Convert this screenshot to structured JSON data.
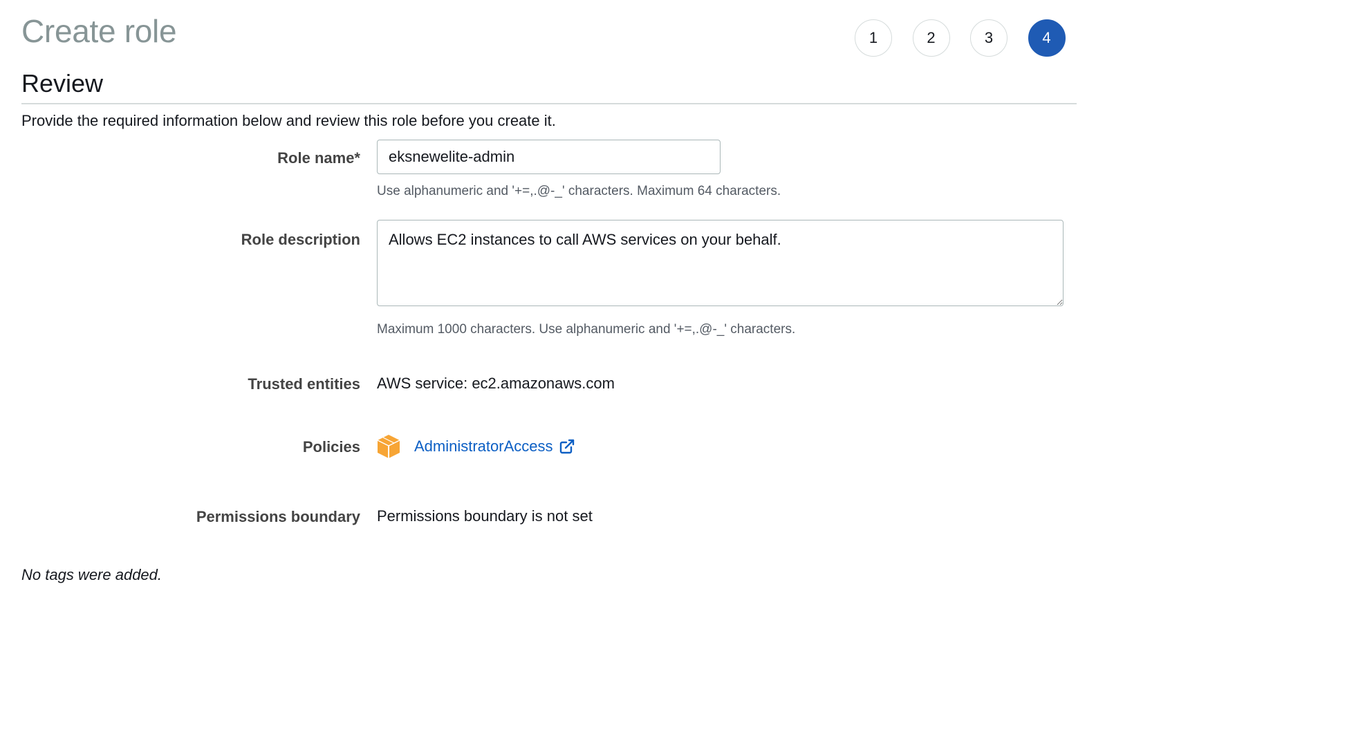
{
  "header": {
    "title": "Create role",
    "steps": [
      "1",
      "2",
      "3",
      "4"
    ],
    "active_step": "4"
  },
  "section": {
    "title": "Review",
    "intro": "Provide the required information below and review this role before you create it."
  },
  "form": {
    "role_name": {
      "label": "Role name*",
      "value": "eksnewelite-admin",
      "hint": "Use alphanumeric and '+=,.@-_' characters. Maximum 64 characters."
    },
    "role_description": {
      "label": "Role description",
      "value": "Allows EC2 instances to call AWS services on your behalf.",
      "hint": "Maximum 1000 characters. Use alphanumeric and '+=,.@-_' characters."
    },
    "trusted_entities": {
      "label": "Trusted entities",
      "value": "AWS service: ec2.amazonaws.com"
    },
    "policies": {
      "label": "Policies",
      "items": [
        {
          "name": "AdministratorAccess",
          "icon": "aws-managed-policy-icon"
        }
      ]
    },
    "permissions_boundary": {
      "label": "Permissions boundary",
      "value": "Permissions boundary is not set"
    }
  },
  "tags": {
    "message": "No tags were added."
  },
  "colors": {
    "accent": "#1f5bb4",
    "link": "#0c5fc4",
    "policy_icon": "#f7a535",
    "title_gray": "#879596"
  }
}
